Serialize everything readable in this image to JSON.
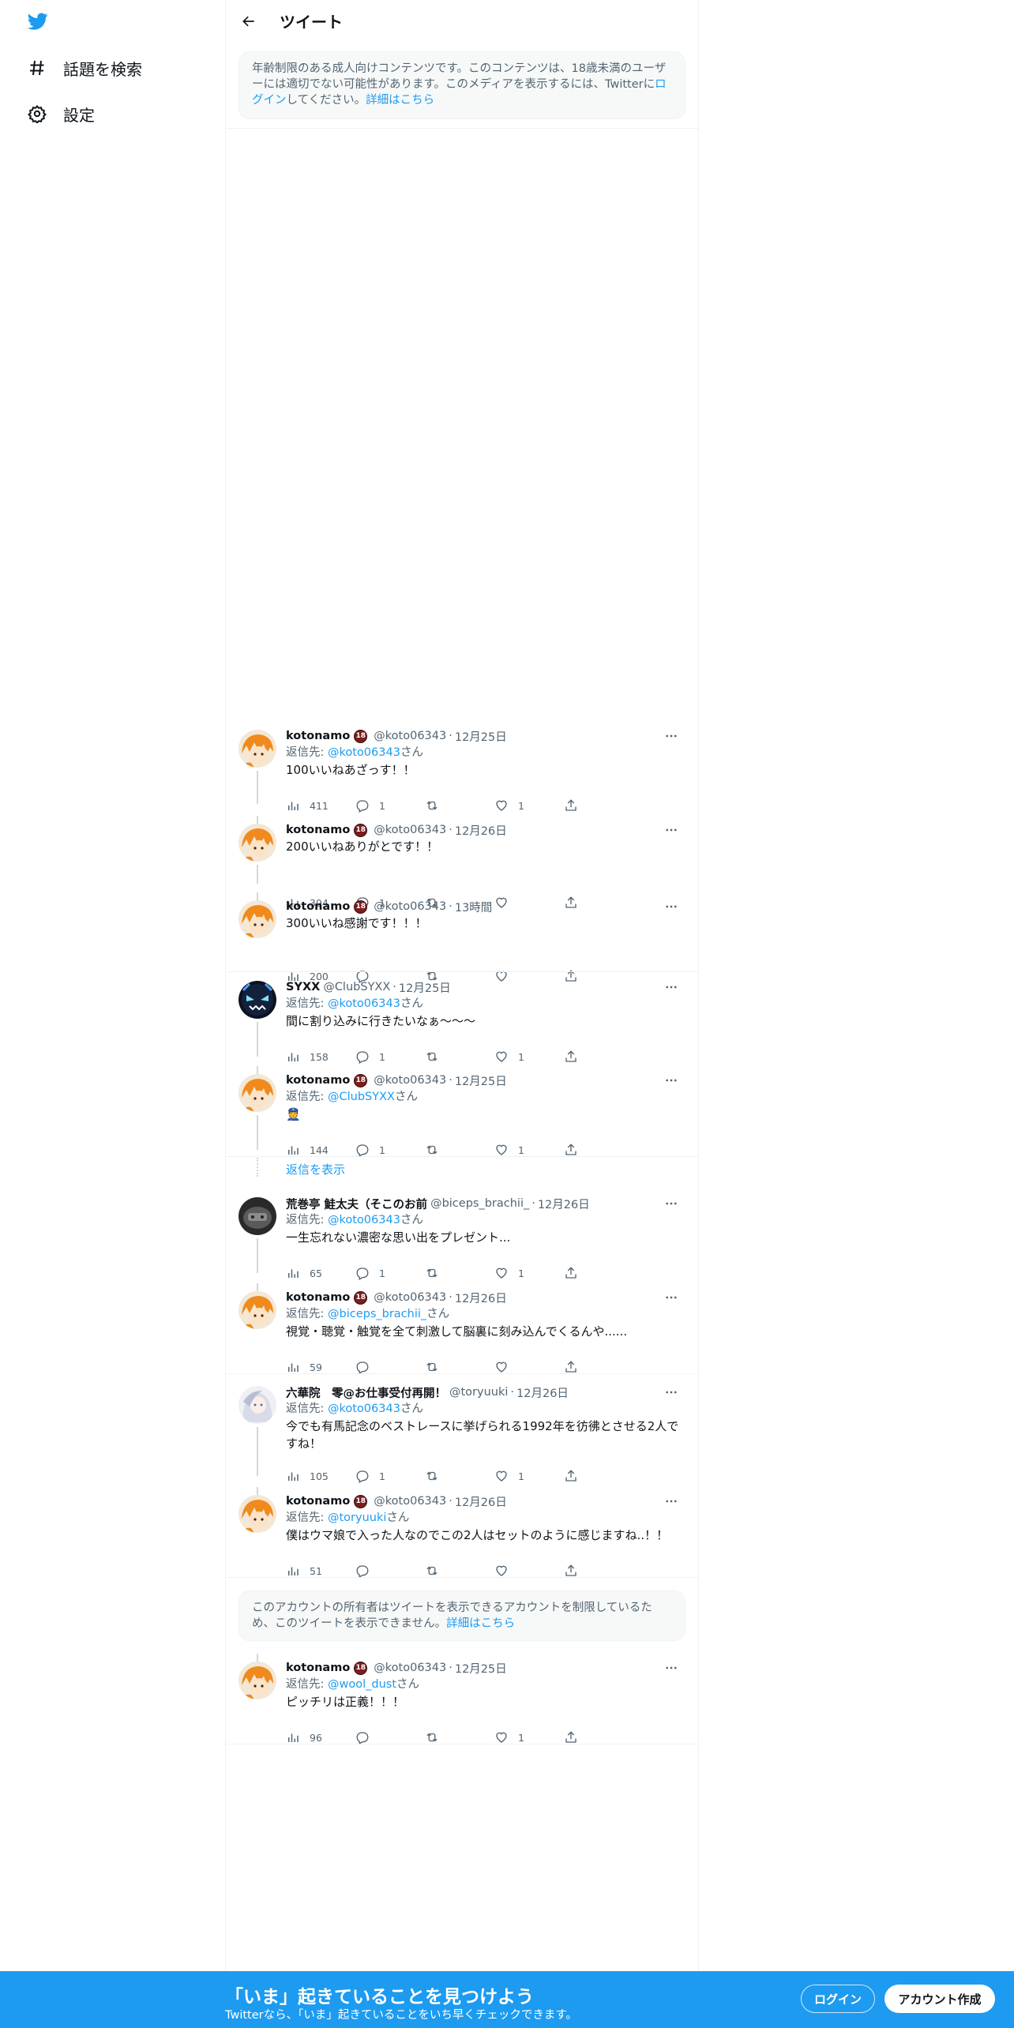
{
  "nav": {
    "items": [
      {
        "label": "話題を検索"
      },
      {
        "label": "設定"
      }
    ]
  },
  "header": {
    "title": "ツイート"
  },
  "notice_top": {
    "text1": "年齢制限のある成人向けコンテンツです。このコンテンツは、18歳未満のユーザーには適切でない可能性があります。このメディアを表示するには、Twitterに",
    "login_link": "ログイン",
    "text2": "してください。",
    "details_link": "詳細はこちら"
  },
  "notice_bottom": {
    "text": "このアカウントの所有者はツイートを表示できるアカウントを制限しているため、このツイートを表示できません。",
    "details_link": "詳細はこちら"
  },
  "reply_prefix": "返信先: ",
  "reply_suffix": "さん",
  "badge": "18",
  "dot": "·",
  "tweets": [
    {
      "name": "kotonamo",
      "handle": "@koto06343",
      "date": "12月25日",
      "reply_to": "@koto06343",
      "text": "100いいねあざっす！！",
      "views": "411",
      "replies": "1",
      "retweets": "",
      "likes": "1"
    },
    {
      "name": "kotonamo",
      "handle": "@koto06343",
      "date": "12月26日",
      "text": "200いいねありがとです！！",
      "views": "394",
      "replies": "1",
      "retweets": "",
      "likes": ""
    },
    {
      "name": "kotonamo",
      "handle": "@koto06343",
      "date": "13時間",
      "text": "300いいね感謝です！！！",
      "views": "200",
      "replies": "",
      "retweets": "",
      "likes": ""
    },
    {
      "name": "SYXX",
      "handle": "@ClubSYXX",
      "date": "12月25日",
      "reply_to": "@koto06343",
      "text": "間に割り込みに行きたいなぁ～～～",
      "views": "158",
      "replies": "1",
      "retweets": "",
      "likes": "1"
    },
    {
      "name": "kotonamo",
      "handle": "@koto06343",
      "date": "12月25日",
      "reply_to": "@ClubSYXX",
      "text": "👮",
      "views": "144",
      "replies": "1",
      "retweets": "",
      "likes": "1"
    },
    {
      "name": "荒巻亭 鮭太夫（そこのお前",
      "handle": "@biceps_brachii_",
      "date": "12月26日",
      "reply_to": "@koto06343",
      "text": "一生忘れない濃密な思い出をプレゼント...",
      "views": "65",
      "replies": "1",
      "retweets": "",
      "likes": "1"
    },
    {
      "name": "kotonamo",
      "handle": "@koto06343",
      "date": "12月26日",
      "reply_to": "@biceps_brachii_",
      "text": "視覚・聴覚・触覚を全て刺激して脳裏に刻み込んでくるんや......",
      "views": "59",
      "replies": "",
      "retweets": "",
      "likes": ""
    },
    {
      "name": "六華院　零@お仕事受付再開！",
      "handle": "@toryuuki",
      "date": "12月26日",
      "reply_to": "@koto06343",
      "text": "今でも有馬記念のベストレースに挙げられる1992年を彷彿とさせる2人ですね！",
      "views": "105",
      "replies": "1",
      "retweets": "",
      "likes": "1"
    },
    {
      "name": "kotonamo",
      "handle": "@koto06343",
      "date": "12月26日",
      "reply_to": "@toryuuki",
      "text": "僕はウマ娘で入った人なのでこの2人はセットのように感じますね..！！",
      "views": "51",
      "replies": "",
      "retweets": "",
      "likes": ""
    },
    {
      "name": "kotonamo",
      "handle": "@koto06343",
      "date": "12月25日",
      "reply_to": "@wool_dust",
      "text": "ピッチリは正義！！！",
      "views": "96",
      "replies": "",
      "retweets": "",
      "likes": "1"
    }
  ],
  "show_replies": "返信を表示",
  "bottombar": {
    "title": "「いま」起きていることを見つけよう",
    "subtitle": "Twitterなら、「いま」起きていることをいち早くチェックできます。",
    "login": "ログイン",
    "signup": "アカウント作成"
  },
  "colors": {
    "accent": "#1d9bf0",
    "muted": "#536471",
    "text": "#0f1419",
    "badge": "#7a1e1e"
  },
  "icons": [
    "twitter-bird-icon",
    "hashtag-icon",
    "gear-icon",
    "back-arrow-icon",
    "more-icon",
    "views-icon",
    "reply-icon",
    "retweet-icon",
    "like-icon",
    "share-icon"
  ]
}
